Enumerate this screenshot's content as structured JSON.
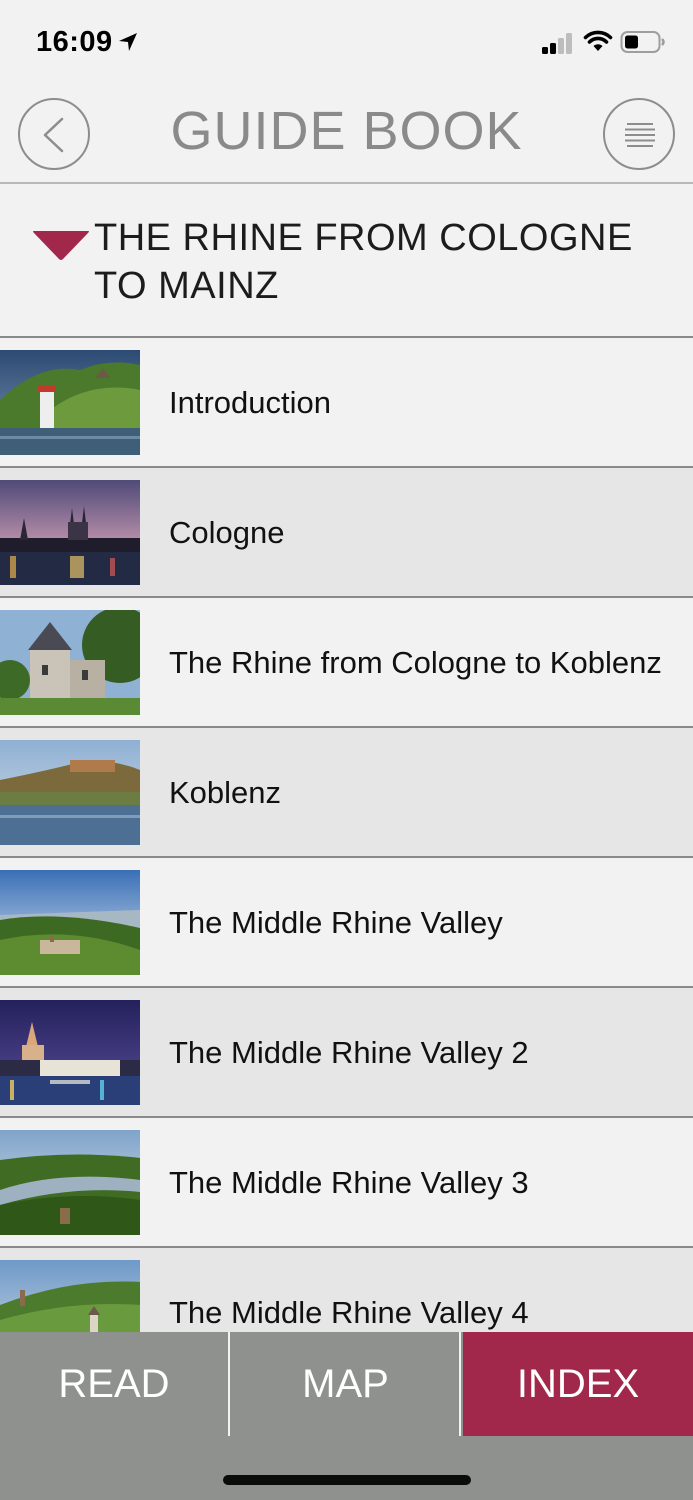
{
  "status": {
    "time": "16:09",
    "icons": [
      "location-arrow-icon",
      "cellular-signal-icon",
      "wifi-icon",
      "battery-icon"
    ]
  },
  "header": {
    "title": "GUIDE BOOK",
    "back_icon": "chevron-left-icon",
    "menu_icon": "menu-lines-icon"
  },
  "section": {
    "title": "THE RHINE FROM COLOGNE TO MAINZ",
    "caret_icon": "caret-down-icon",
    "accent_color": "#a1284a"
  },
  "items": [
    {
      "label": "Introduction"
    },
    {
      "label": "Cologne"
    },
    {
      "label": "The Rhine from Cologne to Koblenz"
    },
    {
      "label": "Koblenz"
    },
    {
      "label": "The Middle Rhine Valley"
    },
    {
      "label": "The Middle Rhine Valley 2"
    },
    {
      "label": "The Middle Rhine Valley 3"
    },
    {
      "label": "The Middle Rhine Valley 4"
    }
  ],
  "tabs": {
    "read": "READ",
    "map": "MAP",
    "index": "INDEX",
    "active": "INDEX",
    "active_color": "#a1284a"
  }
}
